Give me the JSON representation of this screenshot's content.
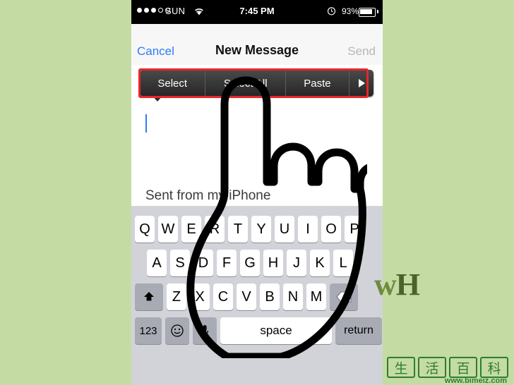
{
  "status_bar": {
    "carrier": "SUN",
    "time": "7:45 PM",
    "battery_percent": "93%",
    "signal_dots_filled": 3,
    "signal_dots_hollow": 2,
    "icons": [
      "wifi-icon",
      "alarm-clock-icon",
      "battery-icon"
    ]
  },
  "nav": {
    "cancel_label": "Cancel",
    "title": "New Message",
    "send_label": "Send"
  },
  "edit_menu": {
    "items": [
      {
        "label": "Select"
      },
      {
        "label": "Select All"
      },
      {
        "label": "Paste"
      }
    ],
    "more_arrow": "▶",
    "highlight_color": "#e8252a"
  },
  "compose": {
    "signature": "Sent from my iPhone",
    "body_value": ""
  },
  "keyboard": {
    "row1": [
      "Q",
      "W",
      "E",
      "R",
      "T",
      "Y",
      "U",
      "I",
      "O",
      "P"
    ],
    "row2": [
      "A",
      "S",
      "D",
      "F",
      "G",
      "H",
      "J",
      "K",
      "L"
    ],
    "row3_shift": "⬆",
    "row3": [
      "Z",
      "X",
      "C",
      "V",
      "B",
      "N",
      "M"
    ],
    "row3_delete": "⊗",
    "row4": {
      "numbers": "123",
      "emoji": "☺",
      "mic": "Ἲ4",
      "space": "space",
      "return": "return"
    }
  },
  "logo": {
    "w": "w",
    "h": "H"
  },
  "watermark": {
    "chars": [
      "生",
      "活",
      "百",
      "科"
    ],
    "url": "www.bimeiz.com",
    "color": "#2e7d32"
  }
}
